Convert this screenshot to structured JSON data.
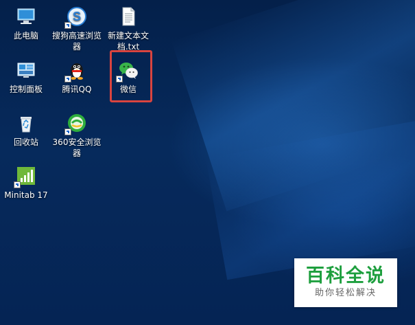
{
  "desktop": {
    "icons": [
      {
        "label": "此电脑",
        "icon": "this-pc-icon"
      },
      {
        "label": "搜狗高速浏览器",
        "icon": "sogou-browser-icon"
      },
      {
        "label": "新建文本文档.txt",
        "icon": "text-file-icon"
      },
      {
        "label": "控制面板",
        "icon": "control-panel-icon"
      },
      {
        "label": "腾讯QQ",
        "icon": "qq-penguin-icon"
      },
      {
        "label": "微信",
        "icon": "wechat-icon"
      },
      {
        "label": "回收站",
        "icon": "recycle-bin-icon"
      },
      {
        "label": "360安全浏览器",
        "icon": "360-browser-icon"
      },
      {
        "label": "Minitab 17",
        "icon": "minitab-icon"
      }
    ],
    "highlight_color": "#d9443f"
  },
  "watermark": {
    "title": "百科全说",
    "subtitle": "助你轻松解决",
    "title_color": "#1e9f3e"
  }
}
